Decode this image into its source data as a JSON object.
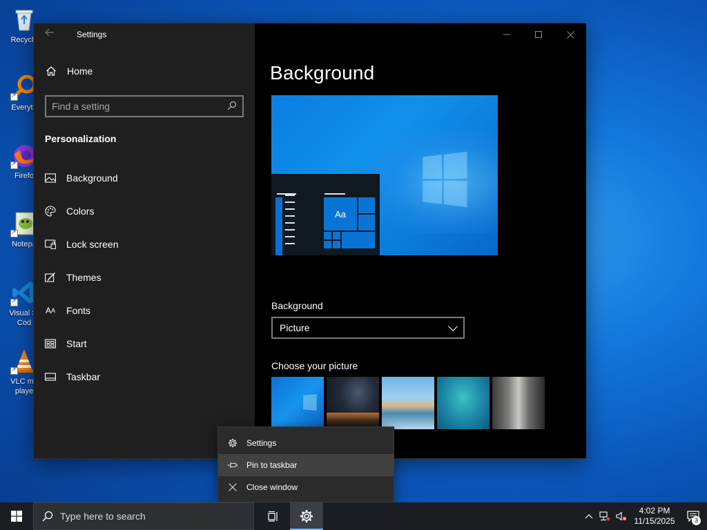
{
  "desktop": {
    "icons": [
      {
        "label": "Recycle",
        "icon": "recycle-bin-icon"
      },
      {
        "label": "Everyth",
        "icon": "everything-search-icon"
      },
      {
        "label": "Firefo",
        "icon": "firefox-icon"
      },
      {
        "label": "Notepa",
        "icon": "notepad-plus-plus-icon"
      },
      {
        "label": "Visual St",
        "label2": "Cod",
        "icon": "vscode-icon"
      },
      {
        "label": "VLC me",
        "label2": "playe",
        "icon": "vlc-icon"
      }
    ]
  },
  "settings": {
    "title": "Settings",
    "home_label": "Home",
    "search_placeholder": "Find a setting",
    "section": "Personalization",
    "nav_items": [
      {
        "label": "Background",
        "icon": "picture-icon"
      },
      {
        "label": "Colors",
        "icon": "palette-icon"
      },
      {
        "label": "Lock screen",
        "icon": "lock-screen-icon"
      },
      {
        "label": "Themes",
        "icon": "brush-icon"
      },
      {
        "label": "Fonts",
        "icon": "font-icon"
      },
      {
        "label": "Start",
        "icon": "start-icon"
      },
      {
        "label": "Taskbar",
        "icon": "taskbar-icon"
      }
    ],
    "selected_nav": "Background",
    "page_title": "Background",
    "preview_sample_text": "Aa",
    "background_label": "Background",
    "background_value": "Picture",
    "choose_picture_label": "Choose your picture",
    "picture_thumbs": [
      "windows-blue",
      "night-sky",
      "beach-rocks",
      "underwater",
      "rock-cliff"
    ]
  },
  "context_menu": {
    "items": [
      {
        "label": "Settings",
        "icon": "gear-icon"
      },
      {
        "label": "Pin to taskbar",
        "icon": "pin-icon",
        "highlighted": true
      },
      {
        "label": "Close window",
        "icon": "close-icon"
      }
    ]
  },
  "taskbar": {
    "search_placeholder": "Type here to search",
    "clock_time": "4:02 PM",
    "clock_date": "11/15/2025",
    "notification_count": "3"
  },
  "colors": {
    "accent": "#0a74d6",
    "sidebar_bg": "#1f1f1f",
    "window_bg": "#000000",
    "taskbar_bg": "#1a1d22"
  }
}
